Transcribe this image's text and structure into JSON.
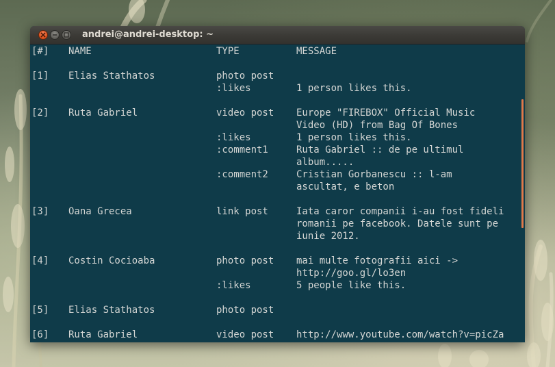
{
  "window": {
    "title": "andrei@andrei-desktop: ~"
  },
  "terminal": {
    "rows": [
      {
        "c1": "[#]",
        "c2": "NAME",
        "c3": "TYPE",
        "c4": "MESSAGE"
      },
      {
        "c1": "",
        "c2": "",
        "c3": "",
        "c4": ""
      },
      {
        "c1": "[1]",
        "c2": "Elias Stathatos",
        "c3": "photo post",
        "c4": ""
      },
      {
        "c1": "",
        "c2": "",
        "c3": ":likes",
        "c4": "1 person likes this."
      },
      {
        "c1": "",
        "c2": "",
        "c3": "",
        "c4": ""
      },
      {
        "c1": "[2]",
        "c2": "Ruta Gabriel",
        "c3": "video post",
        "c4": "Europe \"FIREBOX\" Official Music"
      },
      {
        "c1": "",
        "c2": "",
        "c3": "",
        "c4": "Video (HD) from Bag Of Bones"
      },
      {
        "c1": "",
        "c2": "",
        "c3": ":likes",
        "c4": "1 person likes this."
      },
      {
        "c1": "",
        "c2": "",
        "c3": ":comment1",
        "c4": "Ruta Gabriel :: de pe ultimul"
      },
      {
        "c1": "",
        "c2": "",
        "c3": "",
        "c4": "album....."
      },
      {
        "c1": "",
        "c2": "",
        "c3": ":comment2",
        "c4": "Cristian Gorbanescu :: l-am"
      },
      {
        "c1": "",
        "c2": "",
        "c3": "",
        "c4": "ascultat, e beton"
      },
      {
        "c1": "",
        "c2": "",
        "c3": "",
        "c4": ""
      },
      {
        "c1": "[3]",
        "c2": "Oana Grecea",
        "c3": "link post",
        "c4": "Iata caror companii i-au fost fideli"
      },
      {
        "c1": "",
        "c2": "",
        "c3": "",
        "c4": "romanii pe facebook. Datele sunt pe"
      },
      {
        "c1": "",
        "c2": "",
        "c3": "",
        "c4": "iunie 2012."
      },
      {
        "c1": "",
        "c2": "",
        "c3": "",
        "c4": ""
      },
      {
        "c1": "[4]",
        "c2": "Costin Cocioaba",
        "c3": "photo post",
        "c4": "mai multe fotografii aici ->"
      },
      {
        "c1": "",
        "c2": "",
        "c3": "",
        "c4": "http://goo.gl/lo3en"
      },
      {
        "c1": "",
        "c2": "",
        "c3": ":likes",
        "c4": "5 people like this."
      },
      {
        "c1": "",
        "c2": "",
        "c3": "",
        "c4": ""
      },
      {
        "c1": "[5]",
        "c2": "Elias Stathatos",
        "c3": "photo post",
        "c4": ""
      },
      {
        "c1": "",
        "c2": "",
        "c3": "",
        "c4": ""
      },
      {
        "c1": "[6]",
        "c2": "Ruta Gabriel",
        "c3": "video post",
        "c4": "http://www.youtube.com/watch?v=picZa"
      }
    ]
  },
  "colors": {
    "terminal_bg": "#0f3b49",
    "terminal_fg": "#d4d6d4",
    "close_button": "#e0541f",
    "scrollbar": "#e0794a"
  },
  "icons": {
    "close": "close-icon",
    "minimize": "minimize-icon",
    "maximize": "maximize-icon"
  }
}
